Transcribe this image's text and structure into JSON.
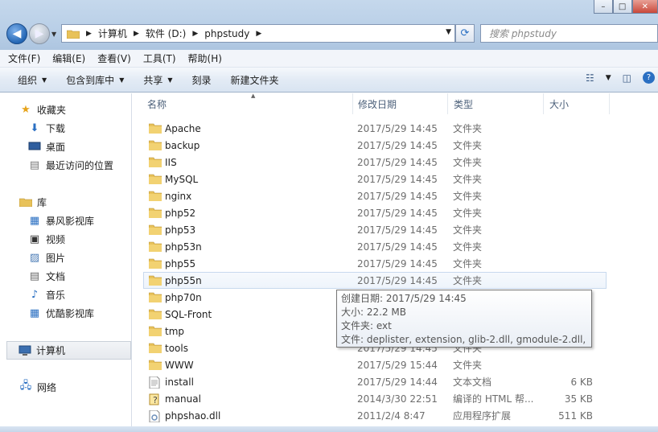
{
  "window": {
    "minimize": "–",
    "maximize": "□",
    "close": "✕"
  },
  "address": {
    "crumbs": [
      "计算机",
      "软件 (D:)",
      "phpstudy"
    ]
  },
  "search": {
    "placeholder": "搜索 phpstudy"
  },
  "menubar": [
    "文件(F)",
    "编辑(E)",
    "查看(V)",
    "工具(T)",
    "帮助(H)"
  ],
  "toolbar": {
    "organize": "组织",
    "include": "包含到库中",
    "share": "共享",
    "burn": "刻录",
    "new_folder": "新建文件夹"
  },
  "sidebar": {
    "favorites": "收藏夹",
    "favorites_items": [
      "下载",
      "桌面",
      "最近访问的位置"
    ],
    "libraries": "库",
    "libraries_items": [
      "暴风影视库",
      "视频",
      "图片",
      "文档",
      "音乐",
      "优酷影视库"
    ],
    "computer": "计算机",
    "network": "网络"
  },
  "columns": {
    "name": "名称",
    "date": "修改日期",
    "type": "类型",
    "size": "大小"
  },
  "files": [
    {
      "name": "Apache",
      "date": "2017/5/29 14:45",
      "type": "文件夹",
      "size": "",
      "icon": "folder-icon"
    },
    {
      "name": "backup",
      "date": "2017/5/29 14:45",
      "type": "文件夹",
      "size": "",
      "icon": "folder-icon"
    },
    {
      "name": "IIS",
      "date": "2017/5/29 14:45",
      "type": "文件夹",
      "size": "",
      "icon": "folder-icon"
    },
    {
      "name": "MySQL",
      "date": "2017/5/29 14:45",
      "type": "文件夹",
      "size": "",
      "icon": "folder-icon"
    },
    {
      "name": "nginx",
      "date": "2017/5/29 14:45",
      "type": "文件夹",
      "size": "",
      "icon": "folder-icon"
    },
    {
      "name": "php52",
      "date": "2017/5/29 14:45",
      "type": "文件夹",
      "size": "",
      "icon": "folder-icon"
    },
    {
      "name": "php53",
      "date": "2017/5/29 14:45",
      "type": "文件夹",
      "size": "",
      "icon": "folder-icon"
    },
    {
      "name": "php53n",
      "date": "2017/5/29 14:45",
      "type": "文件夹",
      "size": "",
      "icon": "folder-icon"
    },
    {
      "name": "php55",
      "date": "2017/5/29 14:45",
      "type": "文件夹",
      "size": "",
      "icon": "folder-icon"
    },
    {
      "name": "php55n",
      "date": "2017/5/29 14:45",
      "type": "文件夹",
      "size": "",
      "icon": "folder-icon"
    },
    {
      "name": "php70n",
      "date": "",
      "type": "",
      "size": "",
      "icon": "folder-icon"
    },
    {
      "name": "SQL-Front",
      "date": "",
      "type": "",
      "size": "",
      "icon": "folder-icon"
    },
    {
      "name": "tmp",
      "date": "",
      "type": "",
      "size": "",
      "icon": "folder-icon"
    },
    {
      "name": "tools",
      "date": "2017/5/29 14:45",
      "type": "文件夹",
      "size": "",
      "icon": "folder-icon"
    },
    {
      "name": "WWW",
      "date": "2017/5/29 15:44",
      "type": "文件夹",
      "size": "",
      "icon": "folder-icon"
    },
    {
      "name": "install",
      "date": "2017/5/29 14:44",
      "type": "文本文档",
      "size": "6 KB",
      "icon": "text-file-icon"
    },
    {
      "name": "manual",
      "date": "2014/3/30 22:51",
      "type": "编译的 HTML 帮...",
      "size": "35 KB",
      "icon": "help-file-icon"
    },
    {
      "name": "phpshao.dll",
      "date": "2011/2/4 8:47",
      "type": "应用程序扩展",
      "size": "511 KB",
      "icon": "dll-file-icon"
    }
  ],
  "tooltip": {
    "created": "创建日期: 2017/5/29 14:45",
    "size": "大小: 22.2 MB",
    "folders": "文件夹: ext",
    "files": "文件: deplister, extension, glib-2.dll, gmodule-2.dll, ..."
  },
  "colors": {
    "accent": "#2466b4",
    "folder": "#e8c25a",
    "highlight": "#c8d9ee"
  }
}
